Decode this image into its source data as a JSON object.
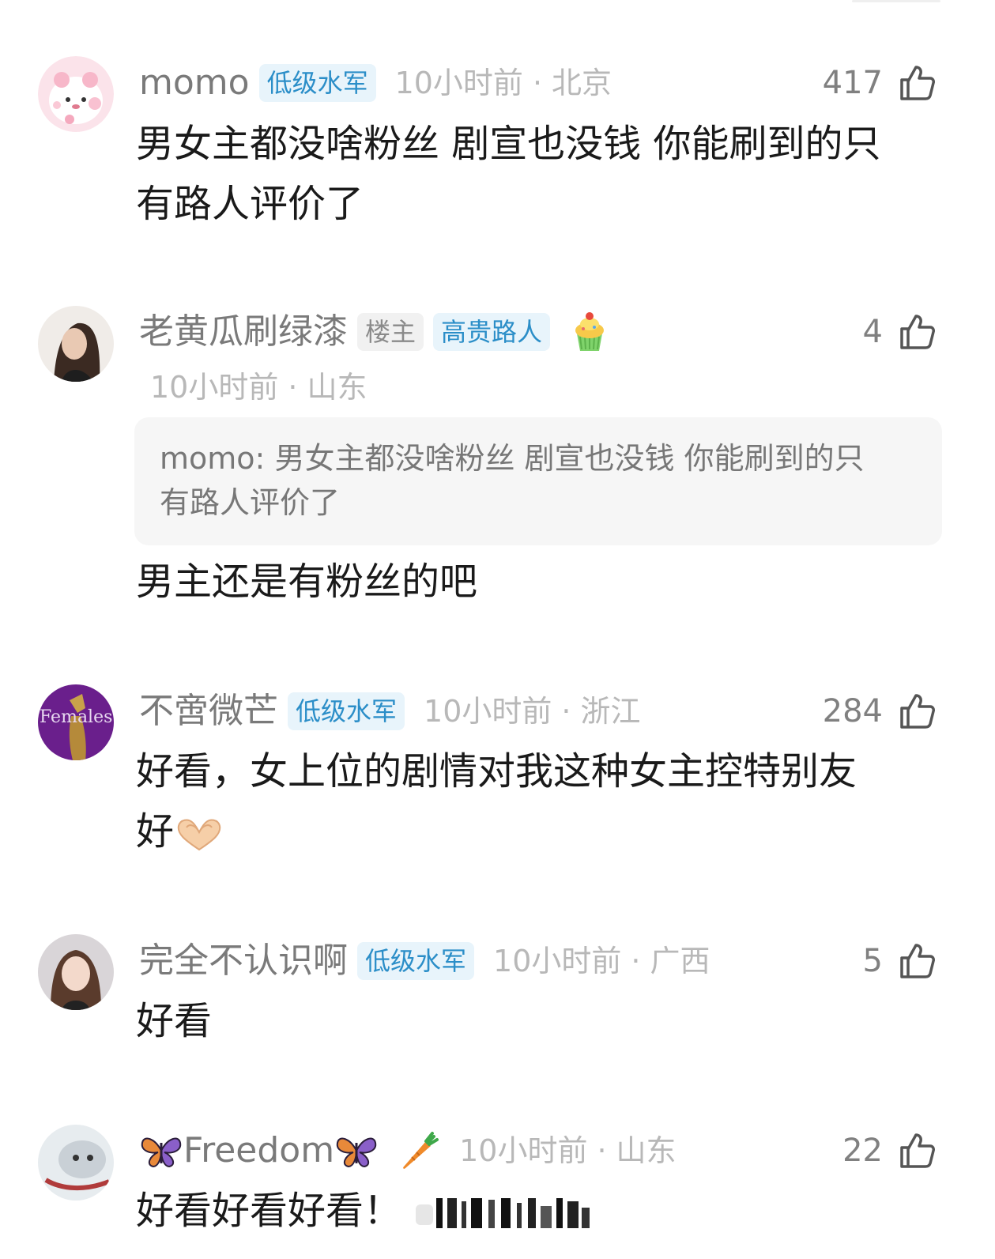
{
  "comments": [
    {
      "username": "momo",
      "badges": [
        "低级水军"
      ],
      "time": "10小时前",
      "location": "北京",
      "likes": "417",
      "text_lines": [
        "男女主都没啥粉丝 剧宣也没钱 你能刷到的只",
        "有路人评价了"
      ]
    },
    {
      "username": "老黄瓜刷绿漆",
      "badges": [
        "楼主",
        "高贵路人"
      ],
      "emoji_badge": "cupcake-icon",
      "time": "10小时前",
      "location": "山东",
      "likes": "4",
      "quote": {
        "author": "momo:",
        "lines": [
          "男女主都没啥粉丝 剧宣也没钱 你能刷到的只",
          "有路人评价了"
        ]
      },
      "text_lines": [
        "男主还是有粉丝的吧"
      ]
    },
    {
      "username": "不啻微芒",
      "badges": [
        "低级水军"
      ],
      "time": "10小时前",
      "location": "浙江",
      "likes": "284",
      "avatar_text": "Females",
      "text_lines": [
        "好看，女上位的剧情对我这种女主控特别友",
        "好"
      ],
      "inline_emoji": "heart-hands-icon"
    },
    {
      "username": "完全不认识啊",
      "badges": [
        "低级水军"
      ],
      "time": "10小时前",
      "location": "广西",
      "likes": "5",
      "text_lines": [
        "好看"
      ]
    },
    {
      "username": "Freedom",
      "username_decoration": "butterfly-icon",
      "emoji_badge": "carrot-icon",
      "time": "10小时前",
      "location": "山东",
      "likes": "22",
      "text_lines": [
        "好看好看好看！"
      ]
    }
  ],
  "separator": "·",
  "colors": {
    "badge_blue_bg": "#e8f4fb",
    "badge_blue_text": "#2b8ec8",
    "username": "#7a7a7a",
    "meta": "#b8b8b8",
    "body": "#1a1a1a"
  }
}
